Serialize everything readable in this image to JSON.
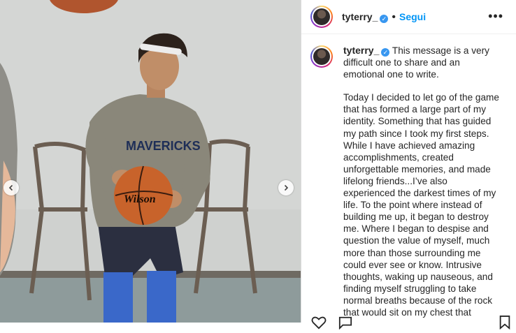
{
  "post": {
    "username": "tyterry_",
    "follow_label": "Segui",
    "more_label": "•••",
    "separator": "•",
    "caption_p1": "This message is a very difficult one to share and an emotional one to write.",
    "caption_p2": "Today I decided to let go of the game that has formed a large part of my identity. Something that has guided my path since I took my first steps. While I have achieved amazing accomplishments, created unforgettable memories, and made lifelong friends...I’ve also experienced the darkest times of my life. To the point where instead of building me up, it began to destroy me. Where I began to despise and question the value of myself, much more than those surrounding me could ever see or know. Intrusive thoughts, waking up nauseous, and finding myself struggling to take normal breaths because of the rock that would sit on my chest that"
  },
  "photo": {
    "shirt_text": "MAVERICKS",
    "ball_text": "Wilson",
    "nav_prev": "previous-arrow",
    "nav_next": "next-arrow"
  },
  "icons": [
    "heart-icon",
    "comment-icon",
    "bookmark-icon",
    "verified-badge-icon",
    "more-icon"
  ],
  "colors": {
    "link": "#0095f6",
    "verified": "#3897f0",
    "text": "#262626"
  }
}
